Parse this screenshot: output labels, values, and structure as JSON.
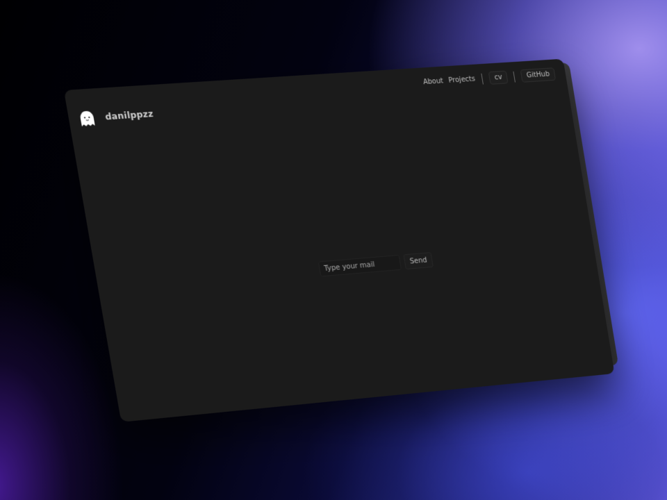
{
  "brand": {
    "name": "danilppzz",
    "logo_icon": "ghost-icon"
  },
  "nav": {
    "about": "About",
    "projects": "Projects",
    "cv": "cv",
    "github": "GitHub"
  },
  "subscribe": {
    "placeholder": "Type your mail",
    "value": "",
    "send_label": "Send"
  },
  "colors": {
    "page_background": "#1b1b1b",
    "text": "#bdbdbd",
    "accent_glow": "#8b7cff"
  }
}
